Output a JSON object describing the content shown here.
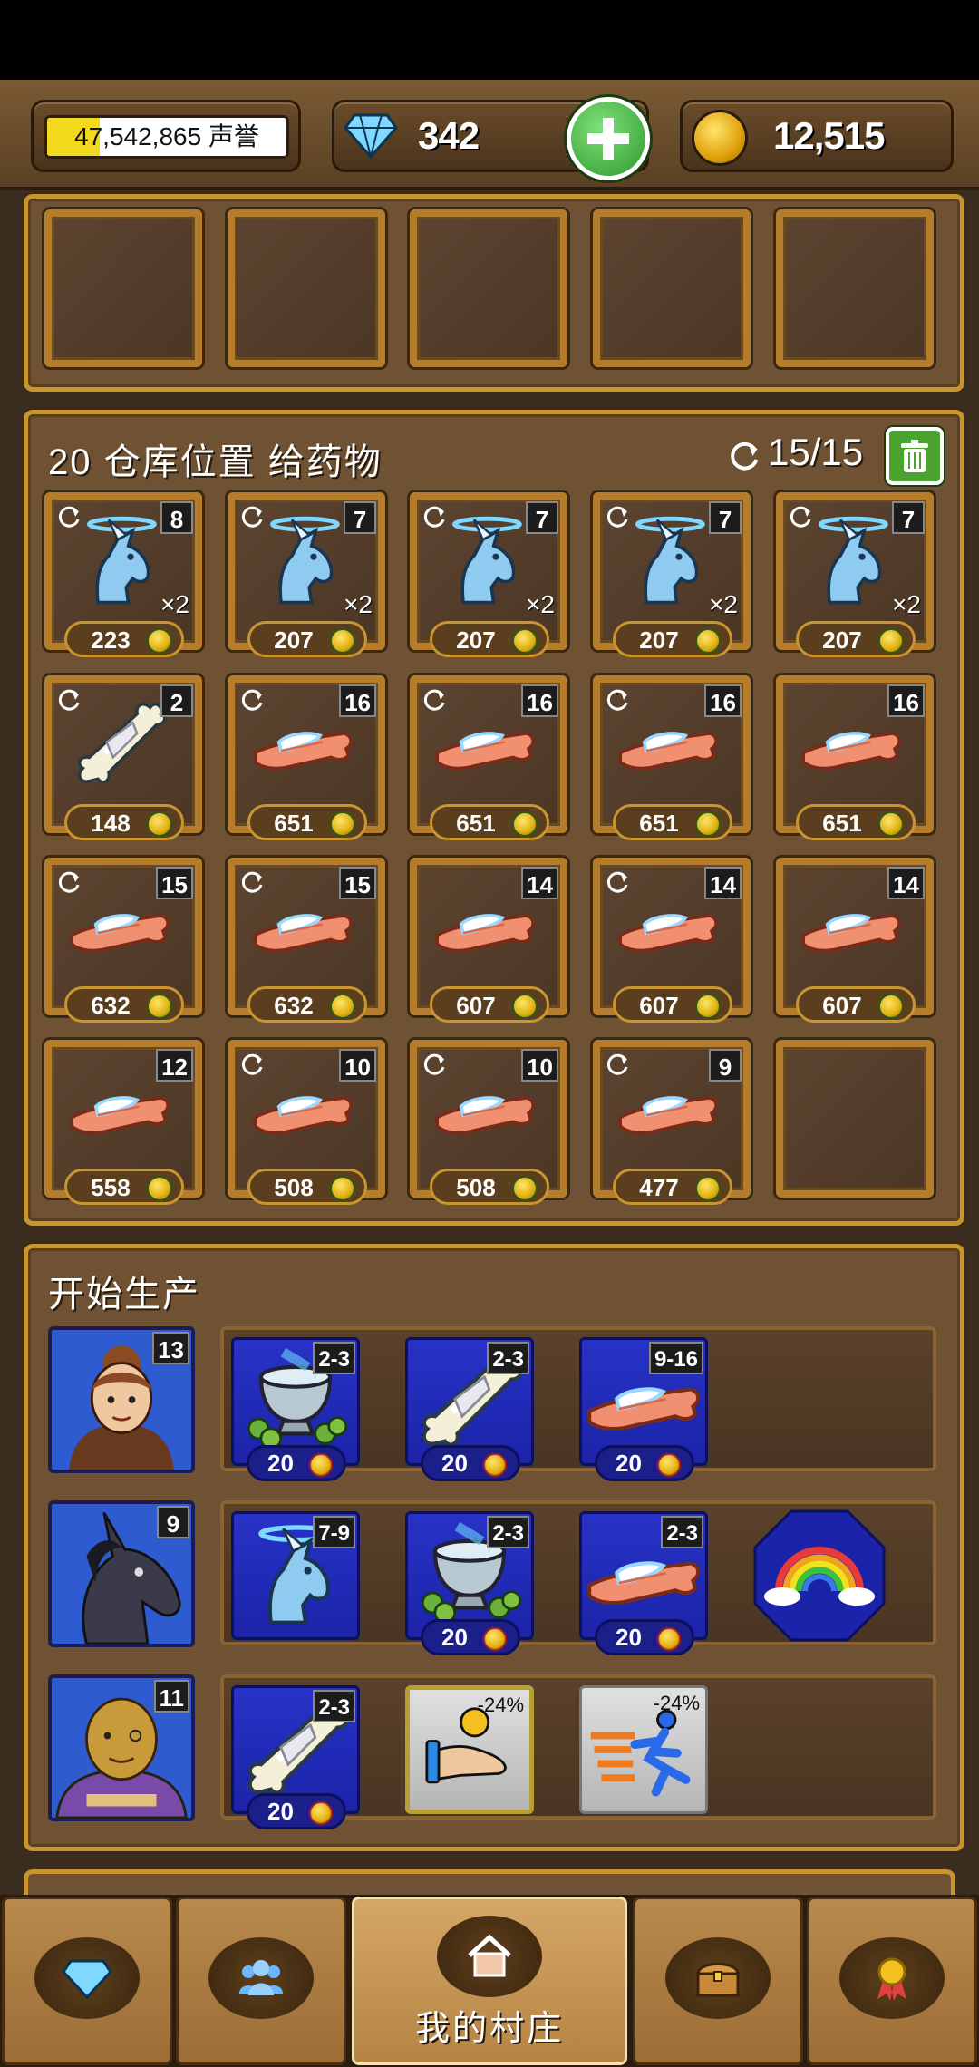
{
  "header": {
    "reputation_text": "47,542,865 声誉",
    "reputation_fill": 0.22,
    "gems": "342",
    "gold": "12,515"
  },
  "storage": {
    "title": "20 仓库位置 给药物",
    "count": "15/15",
    "slots": [
      {
        "item": "unicorn-head-icon",
        "badge": "8",
        "qty": "×2",
        "price": "223",
        "refresh": true
      },
      {
        "item": "unicorn-head-icon",
        "badge": "7",
        "qty": "×2",
        "price": "207",
        "refresh": true
      },
      {
        "item": "unicorn-head-icon",
        "badge": "7",
        "qty": "×2",
        "price": "207",
        "refresh": true
      },
      {
        "item": "unicorn-head-icon",
        "badge": "7",
        "qty": "×2",
        "price": "207",
        "refresh": true
      },
      {
        "item": "unicorn-head-icon",
        "badge": "7",
        "qty": "×2",
        "price": "207",
        "refresh": true
      },
      {
        "item": "bandaged-bone-icon",
        "badge": "2",
        "qty": "",
        "price": "148",
        "refresh": true
      },
      {
        "item": "bandaged-arm-icon",
        "badge": "16",
        "qty": "",
        "price": "651",
        "refresh": true
      },
      {
        "item": "bandaged-arm-icon",
        "badge": "16",
        "qty": "",
        "price": "651",
        "refresh": true
      },
      {
        "item": "bandaged-arm-icon",
        "badge": "16",
        "qty": "",
        "price": "651",
        "refresh": true
      },
      {
        "item": "bandaged-arm-icon",
        "badge": "16",
        "qty": "",
        "price": "651",
        "refresh": false
      },
      {
        "item": "bandaged-arm-icon",
        "badge": "15",
        "qty": "",
        "price": "632",
        "refresh": true
      },
      {
        "item": "bandaged-arm-icon",
        "badge": "15",
        "qty": "",
        "price": "632",
        "refresh": true
      },
      {
        "item": "bandaged-arm-icon",
        "badge": "14",
        "qty": "",
        "price": "607",
        "refresh": false
      },
      {
        "item": "bandaged-arm-icon",
        "badge": "14",
        "qty": "",
        "price": "607",
        "refresh": true
      },
      {
        "item": "bandaged-arm-icon",
        "badge": "14",
        "qty": "",
        "price": "607",
        "refresh": false
      },
      {
        "item": "bandaged-arm-icon",
        "badge": "12",
        "qty": "",
        "price": "558",
        "refresh": false
      },
      {
        "item": "bandaged-arm-icon",
        "badge": "10",
        "qty": "",
        "price": "508",
        "refresh": true
      },
      {
        "item": "bandaged-arm-icon",
        "badge": "10",
        "qty": "",
        "price": "508",
        "refresh": true
      },
      {
        "item": "bandaged-arm-icon",
        "badge": "9",
        "qty": "",
        "price": "477",
        "refresh": true
      }
    ]
  },
  "production": {
    "title": "开始生产",
    "rows": [
      {
        "portrait": "woman-portrait",
        "level": "13",
        "recipes": [
          {
            "item": "mortar-herbs-icon",
            "range": "2-3",
            "cost": "20"
          },
          {
            "item": "bandaged-bone-icon",
            "range": "2-3",
            "cost": "20"
          },
          {
            "item": "bandaged-arm-icon",
            "range": "9-16",
            "cost": "20"
          }
        ]
      },
      {
        "portrait": "unicorn-portrait",
        "level": "9",
        "recipes": [
          {
            "item": "unicorn-head-icon",
            "range": "7-9",
            "cost": ""
          },
          {
            "item": "mortar-herbs-icon",
            "range": "2-3",
            "cost": "20"
          },
          {
            "item": "bandaged-arm-icon",
            "range": "2-3",
            "cost": "20"
          }
        ],
        "special": "rainbow-icon"
      },
      {
        "portrait": "merchant-portrait",
        "level": "11",
        "recipes": [
          {
            "item": "bandaged-bone-icon",
            "range": "2-3",
            "cost": "20"
          }
        ],
        "boosts": [
          {
            "name": "hand-coin-boost-icon",
            "pct": "-24%"
          },
          {
            "name": "runner-speed-boost-icon",
            "pct": "-24%"
          }
        ]
      }
    ]
  },
  "nav": {
    "items": [
      {
        "name": "nav-gems",
        "icon": "diamond-icon",
        "label": ""
      },
      {
        "name": "nav-people",
        "icon": "people-icon",
        "label": ""
      },
      {
        "name": "nav-village",
        "icon": "house-icon",
        "label": "我的村庄"
      },
      {
        "name": "nav-chest",
        "icon": "chest-icon",
        "label": ""
      },
      {
        "name": "nav-award",
        "icon": "medal-icon",
        "label": ""
      }
    ]
  },
  "colors": {
    "gold_frame": "#c9952f",
    "recipe_blue": "#2733c8",
    "trash_green": "#4aa32f"
  }
}
